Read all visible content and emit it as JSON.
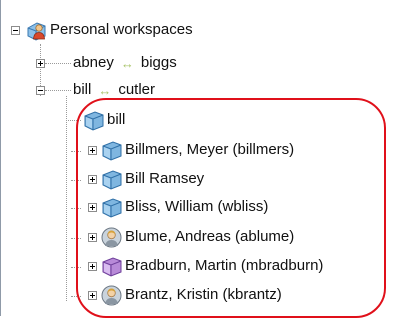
{
  "tree": {
    "root": {
      "label": "Personal workspaces",
      "icon": "workspace-user-icon",
      "expanded": true
    },
    "groups": [
      {
        "left": "abney",
        "right": "biggs",
        "separator": "↔",
        "expanded": false
      },
      {
        "left": "bill",
        "right": "cutler",
        "separator": "↔",
        "expanded": true
      }
    ],
    "items": [
      {
        "label": "bill",
        "icon": "cube-workspace-icon",
        "has_children": false
      },
      {
        "label": "Billmers, Meyer (billmers)",
        "icon": "cube-workspace-icon",
        "has_children": true
      },
      {
        "label": "Bill Ramsey",
        "icon": "cube-workspace-icon",
        "has_children": true
      },
      {
        "label": "Bliss, William  (wbliss)",
        "icon": "cube-workspace-icon",
        "has_children": true
      },
      {
        "label": "Blume, Andreas (ablume)",
        "icon": "user-avatar-icon",
        "has_children": true
      },
      {
        "label": "Bradburn, Martin (mbradburn)",
        "icon": "purple-cube-workspace-icon",
        "has_children": true
      },
      {
        "label": "Brantz, Kristin (kbrantz)",
        "icon": "user-avatar-icon",
        "has_children": true
      }
    ]
  },
  "colors": {
    "highlight": "#e0101a",
    "cube_blue": "#7fb6e0",
    "cube_purple": "#b88ad8",
    "separator": "#a9c46a"
  }
}
